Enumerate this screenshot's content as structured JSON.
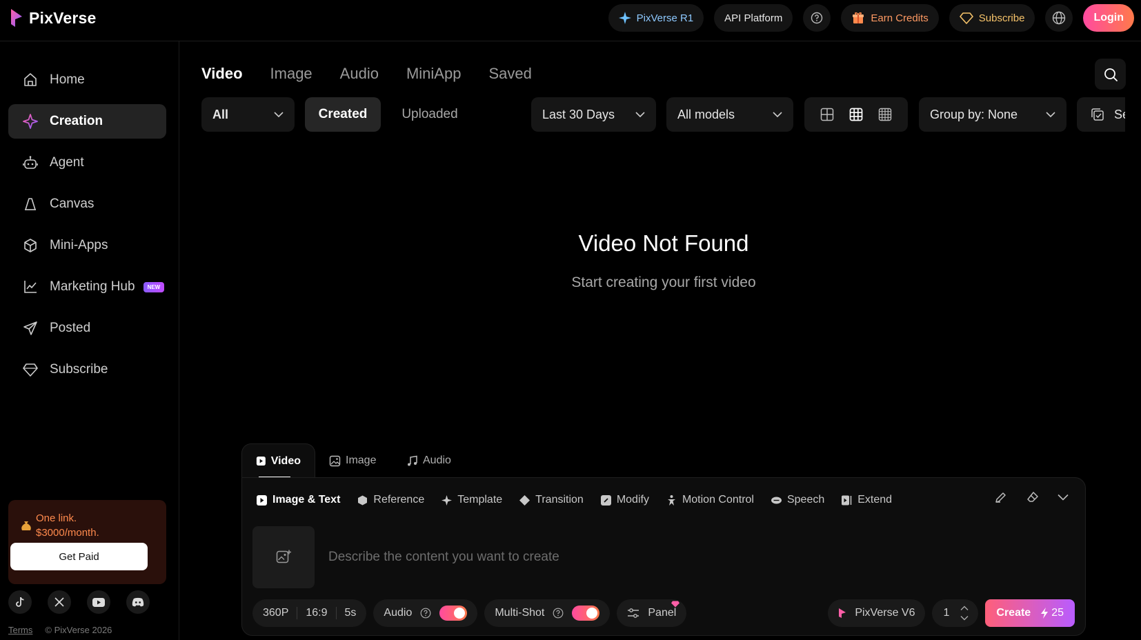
{
  "brand": {
    "name": "PixVerse"
  },
  "topbar": {
    "r1_label": "PixVerse R1",
    "api_label": "API Platform",
    "earn_label": "Earn Credits",
    "subscribe_label": "Subscribe",
    "login_label": "Login"
  },
  "sidebar": {
    "items": [
      {
        "label": "Home",
        "icon": "home-icon"
      },
      {
        "label": "Creation",
        "icon": "sparkle-icon",
        "active": true
      },
      {
        "label": "Agent",
        "icon": "robot-icon"
      },
      {
        "label": "Canvas",
        "icon": "canvas-icon"
      },
      {
        "label": "Mini-Apps",
        "icon": "cube-icon"
      },
      {
        "label": "Marketing Hub",
        "icon": "chart-line-icon",
        "badge": "NEW"
      },
      {
        "label": "Posted",
        "icon": "send-icon"
      },
      {
        "label": "Subscribe",
        "icon": "diamond-icon"
      }
    ],
    "promo": {
      "line1": "One link.",
      "line2": "$3000/month.",
      "button": "Get Paid"
    },
    "footer": {
      "terms": "Terms",
      "copyright": "© PixVerse 2026"
    }
  },
  "main": {
    "tabs": [
      "Video",
      "Image",
      "Audio",
      "MiniApp",
      "Saved"
    ],
    "active_tab": "Video",
    "filters": {
      "type_value": "All",
      "created_label": "Created",
      "uploaded_label": "Uploaded",
      "date_value": "Last 30 Days",
      "model_value": "All models",
      "group_value": "Group by: None",
      "select_label": "Se"
    },
    "empty": {
      "title": "Video Not Found",
      "subtitle": "Start creating your first video"
    }
  },
  "composer": {
    "tabs": [
      "Video",
      "Image",
      "Audio"
    ],
    "modes": [
      "Image & Text",
      "Reference",
      "Template",
      "Transition",
      "Modify",
      "Motion Control",
      "Speech",
      "Extend"
    ],
    "prompt_placeholder": "Describe the content you want to create",
    "settings": {
      "resolution": "360P",
      "ratio": "16:9",
      "duration": "5s"
    },
    "audio_label": "Audio",
    "audio_on": true,
    "multishot_label": "Multi-Shot",
    "multishot_on": true,
    "panel_label": "Panel",
    "model_label": "PixVerse V6",
    "count": "1",
    "create_label": "Create",
    "credits": "25"
  },
  "colors": {
    "accent": "#ff4aa0",
    "accent2": "#ff7a4a",
    "promo_text": "#ff8a4d",
    "r1": "#8ec9ff"
  }
}
